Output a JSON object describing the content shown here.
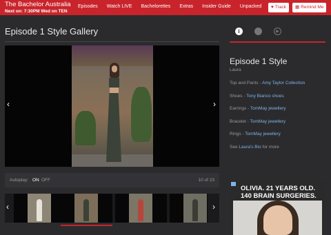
{
  "header": {
    "show_title": "The Bachelor Australia",
    "next_on": "Next on: 7:30PM Wed on TEN",
    "nav": [
      "Episodes",
      "Watch LIVE",
      "Bachelorettes",
      "Extras",
      "Insider Guide",
      "Unpacked"
    ],
    "track_label": "Track",
    "remind_label": "Remind Me",
    "accent": "#c9242b"
  },
  "gallery": {
    "title": "Episode 1 Style Gallery",
    "prev_arrow": "‹",
    "next_arrow": "›",
    "autoplay_label": "Autoplay:",
    "autoplay_on": "ON",
    "autoplay_off": "OFF",
    "counter": "10 of 23"
  },
  "sidebar": {
    "tabs": [
      "info-icon",
      "dot-icon",
      "play-icon"
    ],
    "title": "Episode 1 Style",
    "subtitle": "Laura",
    "details": [
      {
        "label": "Top and Pants - ",
        "link": "Amy Taylor Collection"
      },
      {
        "label": "Shoes - ",
        "link": "Tony Bianco shoes"
      },
      {
        "label": "Earrings - ",
        "link": "TomMay jewellery"
      },
      {
        "label": "Bracelet - ",
        "link": "TomMay jewellery"
      },
      {
        "label": "Rings - ",
        "link": "TomMay jewellery"
      },
      {
        "label": "See ",
        "link": "Laura's Bio",
        "suffix": " for more"
      }
    ]
  },
  "ad": {
    "headline1": "OLIVIA. 21 YEARS OLD.",
    "headline2": "140 BRAIN SURGERIES."
  }
}
